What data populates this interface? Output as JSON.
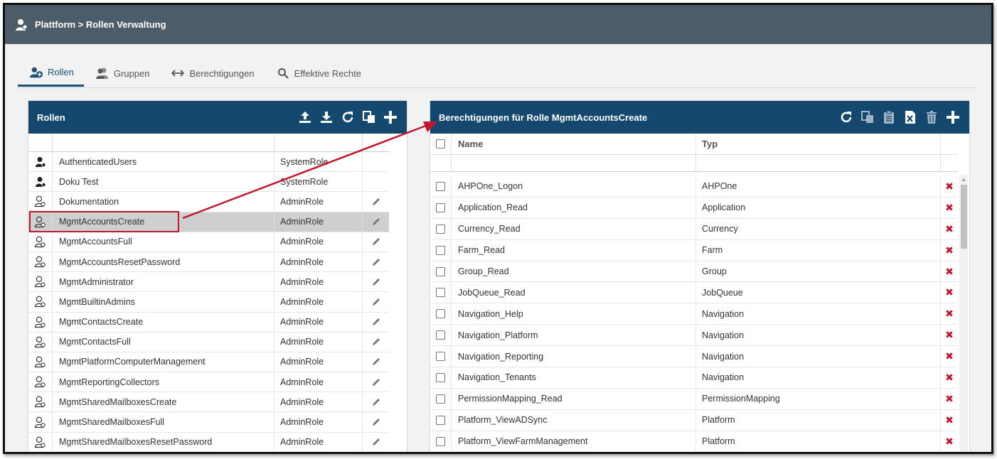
{
  "titlebar": {
    "breadcrumb": "Plattform > Rollen Verwaltung",
    "icon": "user-icon"
  },
  "tabs": [
    {
      "label": "Rollen",
      "icon": "user-add-icon",
      "active": true
    },
    {
      "label": "Gruppen",
      "icon": "group-icon",
      "active": false
    },
    {
      "label": "Berechtigungen",
      "icon": "arrows-horizontal-icon",
      "active": false
    },
    {
      "label": "Effektive Rechte",
      "icon": "search-icon",
      "active": false
    }
  ],
  "left_panel": {
    "title": "Rollen",
    "tools": [
      "upload-icon",
      "download-icon",
      "refresh-icon",
      "copy-icon",
      "plus-icon"
    ],
    "rows": [
      {
        "name": "AuthenticatedUsers",
        "type": "SystemRole",
        "icon": "system-user-icon",
        "editable": false
      },
      {
        "name": "Doku Test",
        "type": "SystemRole",
        "icon": "system-user-icon",
        "editable": false
      },
      {
        "name": "Dokumentation",
        "type": "AdminRole",
        "icon": "admin-user-icon",
        "editable": true
      },
      {
        "name": "MgmtAccountsCreate",
        "type": "AdminRole",
        "icon": "admin-user-icon",
        "editable": true,
        "selected": true
      },
      {
        "name": "MgmtAccountsFull",
        "type": "AdminRole",
        "icon": "admin-user-icon",
        "editable": true
      },
      {
        "name": "MgmtAccountsResetPassword",
        "type": "AdminRole",
        "icon": "admin-user-icon",
        "editable": true
      },
      {
        "name": "MgmtAdministrator",
        "type": "AdminRole",
        "icon": "admin-user-icon",
        "editable": true
      },
      {
        "name": "MgmtBuiltinAdmins",
        "type": "AdminRole",
        "icon": "admin-user-icon",
        "editable": true
      },
      {
        "name": "MgmtContactsCreate",
        "type": "AdminRole",
        "icon": "admin-user-icon",
        "editable": true
      },
      {
        "name": "MgmtContactsFull",
        "type": "AdminRole",
        "icon": "admin-user-icon",
        "editable": true
      },
      {
        "name": "MgmtPlatformComputerManagement",
        "type": "AdminRole",
        "icon": "admin-user-icon",
        "editable": true
      },
      {
        "name": "MgmtReportingCollectors",
        "type": "AdminRole",
        "icon": "admin-user-icon",
        "editable": true
      },
      {
        "name": "MgmtSharedMailboxesCreate",
        "type": "AdminRole",
        "icon": "admin-user-icon",
        "editable": true
      },
      {
        "name": "MgmtSharedMailboxesFull",
        "type": "AdminRole",
        "icon": "admin-user-icon",
        "editable": true
      },
      {
        "name": "MgmtSharedMailboxesResetPassword",
        "type": "AdminRole",
        "icon": "admin-user-icon",
        "editable": true
      }
    ]
  },
  "right_panel": {
    "title": "Berechtigungen für Rolle MgmtAccountsCreate",
    "tools": [
      "refresh-icon",
      "copy-icon",
      "clipboard-icon",
      "excel-icon",
      "trash-icon",
      "plus-icon"
    ],
    "columns": {
      "name": "Name",
      "type": "Typ"
    },
    "rows": [
      {
        "name": "AHPOne_Logon",
        "type": "AHPOne"
      },
      {
        "name": "Application_Read",
        "type": "Application"
      },
      {
        "name": "Currency_Read",
        "type": "Currency"
      },
      {
        "name": "Farm_Read",
        "type": "Farm"
      },
      {
        "name": "Group_Read",
        "type": "Group"
      },
      {
        "name": "JobQueue_Read",
        "type": "JobQueue"
      },
      {
        "name": "Navigation_Help",
        "type": "Navigation"
      },
      {
        "name": "Navigation_Platform",
        "type": "Navigation"
      },
      {
        "name": "Navigation_Reporting",
        "type": "Navigation"
      },
      {
        "name": "Navigation_Tenants",
        "type": "Navigation"
      },
      {
        "name": "PermissionMapping_Read",
        "type": "PermissionMapping"
      },
      {
        "name": "Platform_ViewADSync",
        "type": "Platform"
      },
      {
        "name": "Platform_ViewFarmManagement",
        "type": "Platform"
      }
    ]
  },
  "colors": {
    "titlebar": "#4c5c68",
    "panel_header": "#15486e",
    "highlight": "#c0172f",
    "selected_row": "#cfcfcf"
  }
}
